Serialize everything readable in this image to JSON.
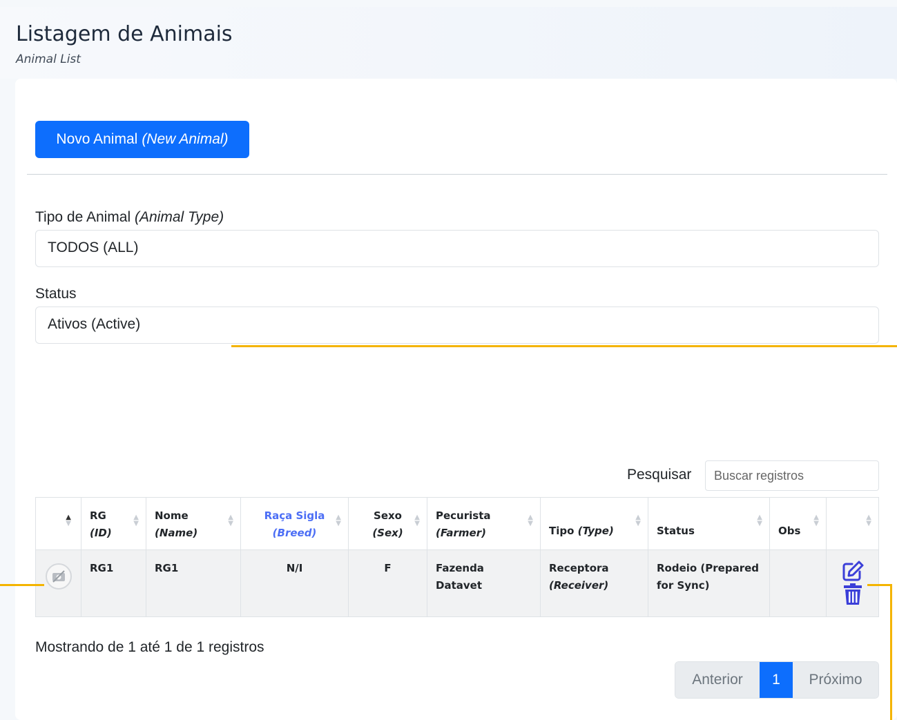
{
  "header": {
    "title": "Listagem de Animais",
    "subtitle": "Animal List"
  },
  "new_button": {
    "label": "Novo Animal",
    "label_en": "(New Animal)"
  },
  "filters": {
    "type_label": "Tipo de Animal",
    "type_label_en": "(Animal Type)",
    "type_value": "TODOS (ALL)",
    "status_label": "Status",
    "status_value": "Ativos (Active)"
  },
  "search": {
    "label": "Pesquisar",
    "placeholder": "Buscar registros"
  },
  "table": {
    "columns": [
      {
        "pt": "RG",
        "en": "(ID)"
      },
      {
        "pt": "Nome",
        "en": "(Name)"
      },
      {
        "pt": "Raça Sigla",
        "en": "(Breed)"
      },
      {
        "pt": "Sexo",
        "en": "(Sex)"
      },
      {
        "pt": "Pecurista",
        "en": "(Farmer)"
      },
      {
        "pt": "Tipo",
        "en": "(Type)"
      },
      {
        "pt": "Status",
        "en": ""
      },
      {
        "pt": "Obs",
        "en": ""
      }
    ],
    "rows": [
      {
        "rg": "RG1",
        "name": "RG1",
        "breed": "N/I",
        "sex": "F",
        "farmer": "Fazenda Datavet",
        "type": "Receptora",
        "type_en": "(Receiver)",
        "status": "Rodeio (Prepared for Sync)",
        "obs": ""
      }
    ]
  },
  "footer": {
    "showing": "Mostrando de 1 até 1 de 1 registros"
  },
  "pagination": {
    "prev": "Anterior",
    "current": "1",
    "next": "Próximo"
  },
  "colors": {
    "primary": "#0d6efd",
    "accent": "#f4b400",
    "breed_header": "#4c6ef5",
    "action_icons": "#3b3fd8"
  }
}
